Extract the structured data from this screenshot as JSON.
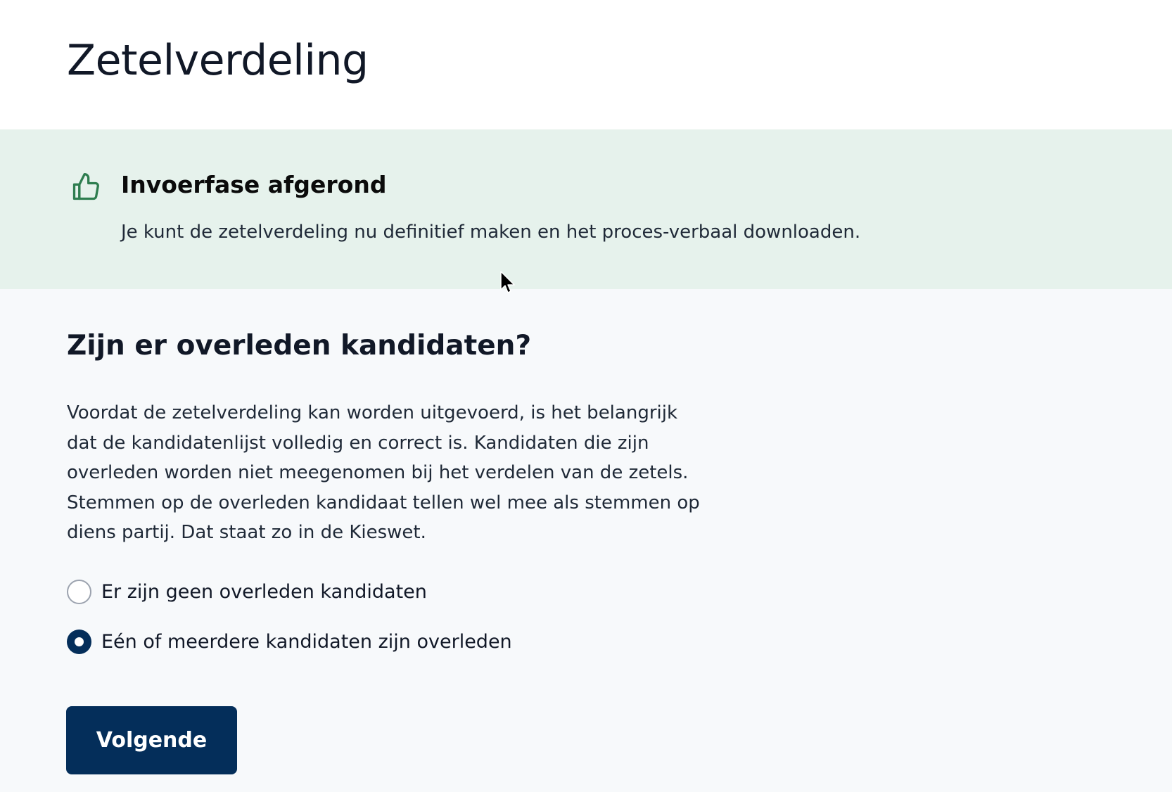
{
  "header": {
    "title": "Zetelverdeling"
  },
  "banner": {
    "icon": "thumbs-up-icon",
    "icon_color": "#2e7d4f",
    "background": "#e6f2ec",
    "title": "Invoerfase afgerond",
    "text": "Je kunt de zetelverdeling nu definitief maken en het proces-verbaal downloaden."
  },
  "main": {
    "section_title": "Zijn er overleden kandidaten?",
    "description": "Voordat de zetelverdeling kan worden uitgevoerd, is het belangrijk dat de kandidatenlijst volledig en correct is. Kandidaten die zijn overleden worden niet meegenomen bij het verdelen van de zetels. Stemmen op de overleden kandidaat tellen wel mee als stemmen op diens partij. Dat staat zo in de Kieswet.",
    "options": [
      {
        "label": "Er zijn geen overleden kandidaten",
        "selected": false
      },
      {
        "label": "Eén of meerdere kandidaten zijn overleden",
        "selected": true
      }
    ],
    "next_button_label": "Volgende",
    "accent_color": "#042e5a"
  }
}
